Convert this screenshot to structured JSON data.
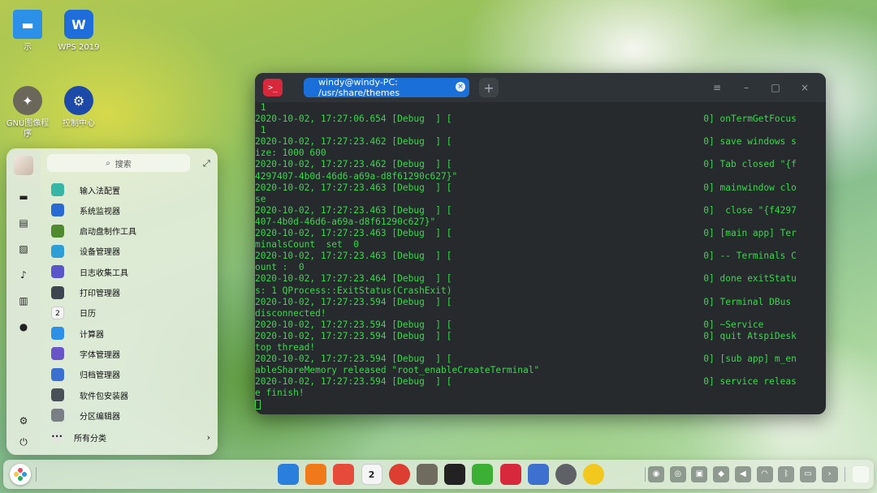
{
  "desktop": {
    "icons": [
      {
        "label": "示",
        "icon": "folder-icon"
      },
      {
        "label": "WPS 2019",
        "icon": "wps-icon"
      },
      {
        "label": "GNU图像程序",
        "icon": "gimp-icon"
      },
      {
        "label": "控制中心",
        "icon": "control-center-icon"
      }
    ]
  },
  "terminal": {
    "app_icon": ">_",
    "tab_title": "windy@windy-PC: /usr/share/themes",
    "tab_close": "×",
    "new_tab": "+",
    "controls": {
      "menu": "≡",
      "minimize": "–",
      "maximize": "□",
      "close": "×"
    },
    "lines": [
      " 1",
      "2020-10-02, 17:27:06.654 [Debug  ] [                                              0] onTermGetFocus",
      " 1",
      "2020-10-02, 17:27:23.462 [Debug  ] [                                              0] save windows s",
      "ize: 1000 600",
      "2020-10-02, 17:27:23.462 [Debug  ] [                                              0] Tab closed \"{f",
      "4297407-4b0d-46d6-a69a-d8f61290c627}\"",
      "2020-10-02, 17:27:23.463 [Debug  ] [                                              0] mainwindow clo",
      "se",
      "2020-10-02, 17:27:23.463 [Debug  ] [                                              0]  close \"{f4297",
      "407-4b0d-46d6-a69a-d8f61290c627}\"",
      "2020-10-02, 17:27:23.463 [Debug  ] [                                              0] [main app] Ter",
      "minalsCount  set  0",
      "2020-10-02, 17:27:23.463 [Debug  ] [                                              0] -- Terminals C",
      "ount :  0",
      "2020-10-02, 17:27:23.464 [Debug  ] [                                              0] done exitStatu",
      "s: 1 QProcess::ExitStatus(CrashExit)",
      "2020-10-02, 17:27:23.594 [Debug  ] [                                              0] Terminal DBus",
      "disconnected!",
      "2020-10-02, 17:27:23.594 [Debug  ] [                                              0] ~Service",
      "2020-10-02, 17:27:23.594 [Debug  ] [                                              0] quit AtspiDesk",
      "top thread!",
      "2020-10-02, 17:27:23.594 [Debug  ] [                                              0] [sub app] m_en",
      "ableShareMemory released \"root_enableCreateTerminal\"",
      "2020-10-02, 17:27:23.594 [Debug  ] [                                              0] service releas",
      "e finish!"
    ]
  },
  "launcher": {
    "search_placeholder": "搜索",
    "search_icon": "⌕",
    "expand_icon": "⤢",
    "side_icons": [
      "monitor-icon",
      "document-icon",
      "picture-icon",
      "music-icon",
      "video-icon",
      "download-icon",
      "settings-icon",
      "power-icon"
    ],
    "apps": [
      {
        "name": "输入法配置",
        "color": "#37b6a6"
      },
      {
        "name": "系统监视器",
        "color": "#2a6bd3"
      },
      {
        "name": "启动盘制作工具",
        "color": "#4f8a2e"
      },
      {
        "name": "设备管理器",
        "color": "#2e9fd6"
      },
      {
        "name": "日志收集工具",
        "color": "#5a55c9"
      },
      {
        "name": "打印管理器",
        "color": "#3d4650"
      },
      {
        "name": "日历",
        "color": "#f4f4f4"
      },
      {
        "name": "计算器",
        "color": "#2d8fe6"
      },
      {
        "name": "字体管理器",
        "color": "#6a55c8"
      },
      {
        "name": "归档管理器",
        "color": "#3b6fd0"
      },
      {
        "name": "软件包安装器",
        "color": "#4a5058"
      },
      {
        "name": "分区编辑器",
        "color": "#7a7f85"
      }
    ],
    "calendar_day": "2",
    "all_categories": "所有分类",
    "all_categories_dots": "•••",
    "chevron": "›"
  },
  "dock": {
    "apps": [
      {
        "name": "store-icon",
        "color": "#2a7fdc"
      },
      {
        "name": "app-market-icon",
        "color": "#f07a1a"
      },
      {
        "name": "photos-icon",
        "color": "#e64a3b"
      },
      {
        "name": "calendar-icon",
        "color": "#f5f5f5"
      },
      {
        "name": "chrome-icon",
        "color": "#dd3e32"
      },
      {
        "name": "gimp-icon",
        "color": "#6f6b5e"
      },
      {
        "name": "qq-icon",
        "color": "#222222"
      },
      {
        "name": "wechat-icon",
        "color": "#3cb034"
      },
      {
        "name": "terminal-icon",
        "color": "#d8283c"
      },
      {
        "name": "archive-icon",
        "color": "#3e70d0"
      },
      {
        "name": "disk-icon",
        "color": "#5e6166"
      },
      {
        "name": "player-icon",
        "color": "#f2c81c"
      }
    ],
    "calendar_day": "2",
    "tray": [
      {
        "name": "tray-app-icon",
        "glyph": "◉"
      },
      {
        "name": "tray-steam-icon",
        "glyph": "◎"
      },
      {
        "name": "tray-game-icon",
        "glyph": "▣"
      },
      {
        "name": "tray-qq-icon",
        "glyph": "◆"
      },
      {
        "name": "tray-volume-icon",
        "glyph": "◀"
      },
      {
        "name": "tray-network-icon",
        "glyph": "◠"
      },
      {
        "name": "tray-bluetooth-icon",
        "glyph": "ᛒ"
      },
      {
        "name": "tray-battery-icon",
        "glyph": "▭"
      },
      {
        "name": "tray-expand-icon",
        "glyph": "›"
      }
    ]
  }
}
